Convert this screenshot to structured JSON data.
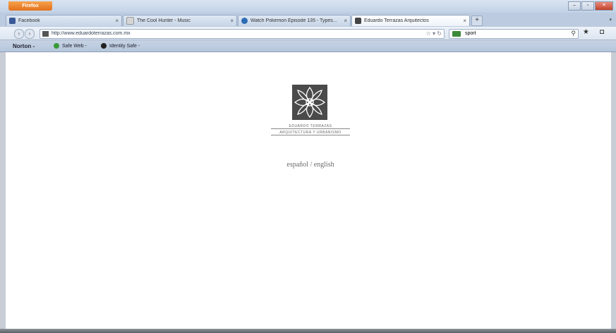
{
  "window": {
    "app_button": "Firefox",
    "controls": [
      "–",
      "▫",
      "✕"
    ]
  },
  "tabs": [
    {
      "label": "Facebook",
      "icon": "facebook-icon",
      "color": "#3b5998"
    },
    {
      "label": "The Cool Hunter - Music",
      "icon": "page-icon",
      "color": "#d6d6d6"
    },
    {
      "label": "Watch Pokemon Episode 135 - Types...",
      "icon": "globe-icon",
      "color": "#2d6db5"
    },
    {
      "label": "Eduardo Terrazas Arquitectos",
      "icon": "site-icon",
      "color": "#444444"
    }
  ],
  "navbar": {
    "url": "http://www.eduardoterrazas.com.mx",
    "search_value": "sport",
    "search_engine_color": "#3a8a3a"
  },
  "bookmarks": [
    {
      "label": "Norton -"
    },
    {
      "label": "Safe Web -",
      "color": "#3a9a3a"
    },
    {
      "label": "Identity Safe -",
      "color": "#222222"
    }
  ],
  "page": {
    "logo_name": "EDUARDO TERRAZAS",
    "logo_sub": "ARQUITECTURA Y URBANISMO",
    "lang_es": "español",
    "lang_sep": " / ",
    "lang_en": "english"
  }
}
